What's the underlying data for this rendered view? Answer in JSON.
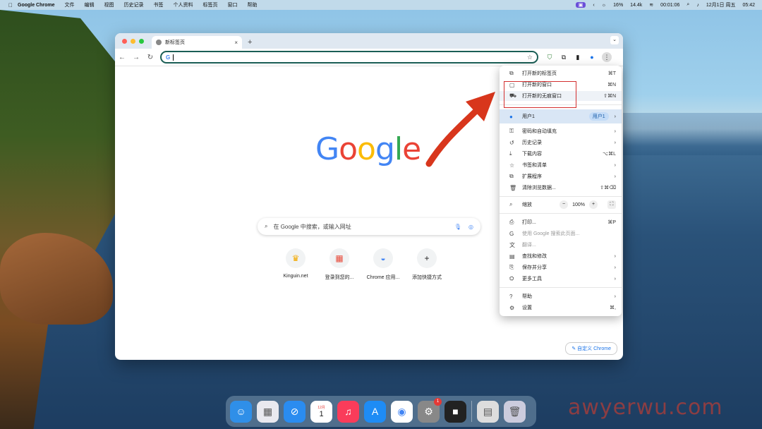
{
  "menubar": {
    "apple": "",
    "app_name": "Google Chrome",
    "items": [
      "文件",
      "编辑",
      "视图",
      "历史记录",
      "书签",
      "个人资料",
      "标签页",
      "窗口",
      "帮助"
    ],
    "status": {
      "battery_pct": "16%",
      "timer": "00:01:06",
      "date": "12月1日 周五",
      "time": "05:42",
      "speed": "14.4k"
    }
  },
  "window": {
    "tab_title": "新标签页",
    "new_tab": "+",
    "tab_close": "×",
    "tab_menu": "⌄",
    "omnibox_value": "",
    "omnibox_icon": "G"
  },
  "page": {
    "logo": [
      "G",
      "o",
      "o",
      "g",
      "l",
      "e"
    ],
    "logo_colors": [
      "#4285F4",
      "#EA4335",
      "#FBBC05",
      "#4285F4",
      "#34A853",
      "#EA4335"
    ],
    "search_placeholder": "在 Google 中搜索，或输入网址",
    "shortcuts": [
      {
        "label": "Kinguin.net",
        "icon": "crown-icon",
        "glyph": "♛",
        "color": "#f2a900"
      },
      {
        "label": "登录到您的...",
        "icon": "microsoft-icon",
        "glyph": "▦",
        "color": "#e74c3c"
      },
      {
        "label": "Chrome 应用...",
        "icon": "chrome-webstore-icon",
        "glyph": "◒",
        "color": "#4285f4"
      },
      {
        "label": "添加快捷方式",
        "icon": "plus-icon",
        "glyph": "+",
        "color": "#333"
      }
    ],
    "customize": "自定义 Chrome"
  },
  "menu": {
    "new_tab": {
      "label": "打开新的标签页",
      "shortcut": "⌘T"
    },
    "new_window": {
      "label": "打开新的窗口",
      "shortcut": "⌘N"
    },
    "incognito": {
      "label": "打开新的无痕窗口",
      "shortcut": "⇧⌘N"
    },
    "profile": {
      "label": "用户1",
      "badge": "用户1"
    },
    "passwords": {
      "label": "密码和自动填充"
    },
    "history": {
      "label": "历史记录"
    },
    "downloads": {
      "label": "下载内容",
      "shortcut": "⌥⌘L"
    },
    "bookmarks": {
      "label": "书签和清单"
    },
    "extensions": {
      "label": "扩展程序"
    },
    "clear": {
      "label": "清除浏览数据...",
      "shortcut": "⇧⌘⌫"
    },
    "zoom": {
      "label": "缩放",
      "value": "100%",
      "minus": "−",
      "plus": "+"
    },
    "print": {
      "label": "打印...",
      "shortcut": "⌘P"
    },
    "search_page": {
      "label": "使用 Google 搜索此页面..."
    },
    "translate": {
      "label": "翻译..."
    },
    "find": {
      "label": "查找和修改"
    },
    "save_share": {
      "label": "保存并分享"
    },
    "more_tools": {
      "label": "更多工具"
    },
    "help": {
      "label": "帮助"
    },
    "settings": {
      "label": "设置",
      "shortcut": "⌘,"
    }
  },
  "dock": [
    {
      "name": "finder",
      "glyph": "☺",
      "bg": "#2f8fe8"
    },
    {
      "name": "launchpad",
      "glyph": "▦",
      "bg": "#e9e9ef"
    },
    {
      "name": "safari",
      "glyph": "⊘",
      "bg": "#2a8cf0"
    },
    {
      "name": "calendar",
      "glyph": "1",
      "bg": "#ffffff",
      "label": "12月"
    },
    {
      "name": "music",
      "glyph": "♫",
      "bg": "#fa3c5a"
    },
    {
      "name": "app-store",
      "glyph": "A",
      "bg": "#1e8cf5"
    },
    {
      "name": "chrome",
      "glyph": "◉",
      "bg": "#ffffff"
    },
    {
      "name": "system-settings",
      "glyph": "⚙",
      "bg": "#888",
      "badge": "1"
    },
    {
      "name": "facetime",
      "glyph": "■",
      "bg": "#222"
    },
    {
      "name": "document",
      "glyph": "▤",
      "bg": "#ddd"
    },
    {
      "name": "trash",
      "glyph": "🗑",
      "bg": "#ccd"
    }
  ],
  "watermark": "awyerwu.com"
}
